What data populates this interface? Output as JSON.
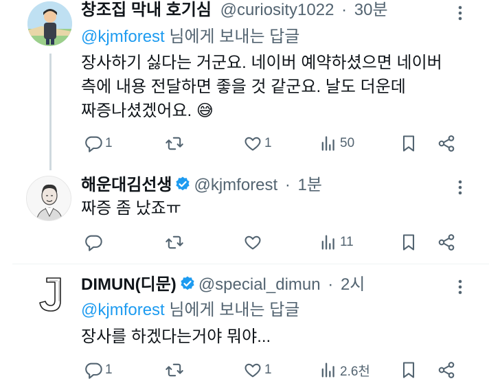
{
  "tweets": [
    {
      "name": "창조집 막내 호기심",
      "handle": "@curiosity1022",
      "dot": "·",
      "time": "30분",
      "verified": false,
      "reply_to": {
        "mention": "@kjmforest",
        "suffix": " 님에게 보내는 답글"
      },
      "lines": [
        "장사하기 싫다는 거군요. 네이버 예약하셨으면 네이버",
        "측에 내용 전달하면 좋을 것 같군요. 날도 더운데",
        "짜증나셨겠어요. 😅"
      ],
      "stats": {
        "replies": "1",
        "retweets": "",
        "likes": "1",
        "views": "50"
      }
    },
    {
      "name": "해운대김선생",
      "handle": "@kjmforest",
      "dot": "·",
      "time": "1분",
      "verified": true,
      "lines": [
        "짜증 좀 났죠ㅠ"
      ],
      "stats": {
        "replies": "",
        "retweets": "",
        "likes": "",
        "views": "11"
      }
    },
    {
      "name": "DIMUN(디문)",
      "handle": "@special_dimun",
      "dot": "·",
      "time": "2시",
      "verified": true,
      "reply_to": {
        "mention": "@kjmforest",
        "suffix": " 님에게 보내는 답글"
      },
      "lines": [
        "장사를 하겠다는거야 뭐야..."
      ],
      "stats": {
        "replies": "1",
        "retweets": "",
        "likes": "1",
        "views": "2.6천"
      }
    }
  ],
  "colors": {
    "accent": "#1d9bf0",
    "muted": "#536471",
    "text": "#0f1419"
  },
  "icons": [
    "reply-icon",
    "retweet-icon",
    "like-icon",
    "views-icon",
    "bookmark-icon",
    "share-icon",
    "more-icon",
    "verified-badge-icon"
  ]
}
